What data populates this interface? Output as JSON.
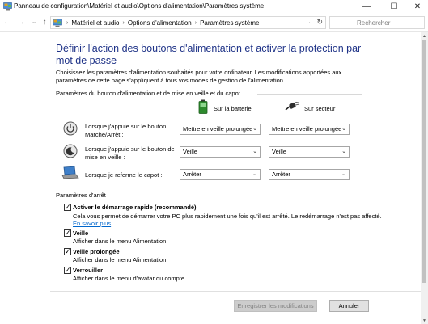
{
  "window": {
    "title": "Panneau de configuration\\Matériel et audio\\Options d'alimentation\\Paramètres système",
    "minimize": "—",
    "maximize": "☐",
    "close": "✕"
  },
  "nav": {
    "back": "←",
    "forward": "→",
    "history": "⌄",
    "up": "↑",
    "breadcrumb": [
      "Matériel et audio",
      "Options d'alimentation",
      "Paramètres système"
    ],
    "separator": "›",
    "dropdown": "⌄",
    "refresh": "↻",
    "search_placeholder": "Rechercher"
  },
  "page": {
    "heading": "Définir l'action des boutons d'alimentation et activer la protection par mot de passe",
    "intro": "Choisissez les paramètres d'alimentation souhaités pour votre ordinateur. Les modifications apportées aux paramètres de cette page s'appliquent à tous vos modes de gestion de l'alimentation."
  },
  "buttons_section": {
    "title": "Paramètres du bouton d'alimentation et de mise en veille et du capot",
    "col_battery": "Sur la batterie",
    "col_plugged": "Sur secteur",
    "battery_icon": "battery-icon",
    "plug_icon": "power-plug-icon",
    "rows": [
      {
        "icon": "power-button-icon",
        "label": "Lorsque j'appuie sur le bouton Marche/Arrêt :",
        "battery": "Mettre en veille prolongée",
        "plugged": "Mettre en veille prolongée"
      },
      {
        "icon": "sleep-button-icon",
        "label": "Lorsque j'appuie sur le bouton de mise en veille :",
        "battery": "Veille",
        "plugged": "Veille"
      },
      {
        "icon": "laptop-lid-icon",
        "label": "Lorsque je referme le capot :",
        "battery": "Arrêter",
        "plugged": "Arrêter"
      }
    ],
    "select_arrow": "⌄"
  },
  "shutdown_section": {
    "title": "Paramètres d'arrêt",
    "options": [
      {
        "label": "Activer le démarrage rapide (recommandé)",
        "desc": "Cela vous permet de démarrer votre PC plus rapidement une fois qu'il est arrêté. Le redémarrage n'est pas affecté.",
        "link": "En savoir plus",
        "checked": true
      },
      {
        "label": "Veille",
        "desc": "Afficher dans le menu Alimentation.",
        "checked": true
      },
      {
        "label": "Veille prolongée",
        "desc": "Afficher dans le menu Alimentation.",
        "checked": true
      },
      {
        "label": "Verrouiller",
        "desc": "Afficher dans le menu d'avatar du compte.",
        "checked": true
      }
    ],
    "check_glyph": "✓"
  },
  "footer": {
    "save": "Enregistrer les modifications",
    "cancel": "Annuler"
  },
  "scrollbar": {
    "up": "▲",
    "down": "▼"
  },
  "colors": {
    "heading": "#1e3287",
    "link": "#0066cc"
  }
}
